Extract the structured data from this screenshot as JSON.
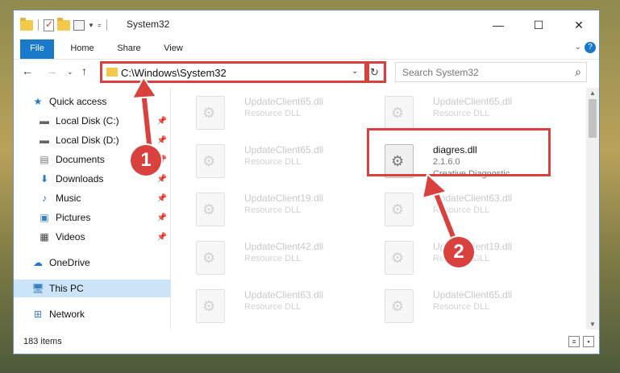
{
  "window": {
    "title": "System32",
    "controls": {
      "minimize": "—",
      "maximize": "☐",
      "close": "✕"
    }
  },
  "ribbon": {
    "tabs": [
      {
        "label": "File",
        "active": true
      },
      {
        "label": "Home"
      },
      {
        "label": "Share"
      },
      {
        "label": "View"
      }
    ],
    "help": "?"
  },
  "address": {
    "path": "C:\\Windows\\System32",
    "search_placeholder": "Search System32"
  },
  "nav": {
    "items": [
      {
        "label": "Quick access",
        "icon": "star-icon"
      },
      {
        "label": "Local Disk (C:)",
        "icon": "drive-icon",
        "pinned": true
      },
      {
        "label": "Local Disk (D:)",
        "icon": "drive-icon",
        "pinned": true
      },
      {
        "label": "Documents",
        "icon": "documents-icon",
        "pinned": true
      },
      {
        "label": "Downloads",
        "icon": "downloads-icon",
        "pinned": true
      },
      {
        "label": "Music",
        "icon": "music-icon",
        "pinned": true
      },
      {
        "label": "Pictures",
        "icon": "pictures-icon",
        "pinned": true
      },
      {
        "label": "Videos",
        "icon": "videos-icon",
        "pinned": true
      },
      {
        "label": "OneDrive",
        "icon": "cloud-icon"
      },
      {
        "label": "This PC",
        "icon": "computer-icon",
        "selected": true
      },
      {
        "label": "Network",
        "icon": "network-icon"
      }
    ]
  },
  "files": [
    {
      "name": "UpdateClient65.dll",
      "desc": "Resource DLL"
    },
    {
      "name": "UpdateClient65.dll",
      "desc": "Resource DLL"
    },
    {
      "name": "UpdateClient65.dll",
      "desc": "Resource DLL"
    },
    {
      "name": "diagres.dll",
      "version": "2.1.6.0",
      "company": "Creative Diagnostic...",
      "active": true
    },
    {
      "name": "UpdateClient19.dll",
      "desc": "Resource DLL"
    },
    {
      "name": "UpdateClient63.dll",
      "desc": "Resource DLL"
    },
    {
      "name": "UpdateClient42.dll",
      "desc": "Resource DLL"
    },
    {
      "name": "UpdateClient19.dll",
      "desc": "Resource DLL"
    },
    {
      "name": "UpdateClient63.dll",
      "desc": "Resource DLL"
    },
    {
      "name": "UpdateClient65.dll",
      "desc": "Resource DLL"
    }
  ],
  "status": {
    "item_count": "183 items"
  },
  "annotations": {
    "step1": "1",
    "step2": "2",
    "color": "#d9413f"
  }
}
